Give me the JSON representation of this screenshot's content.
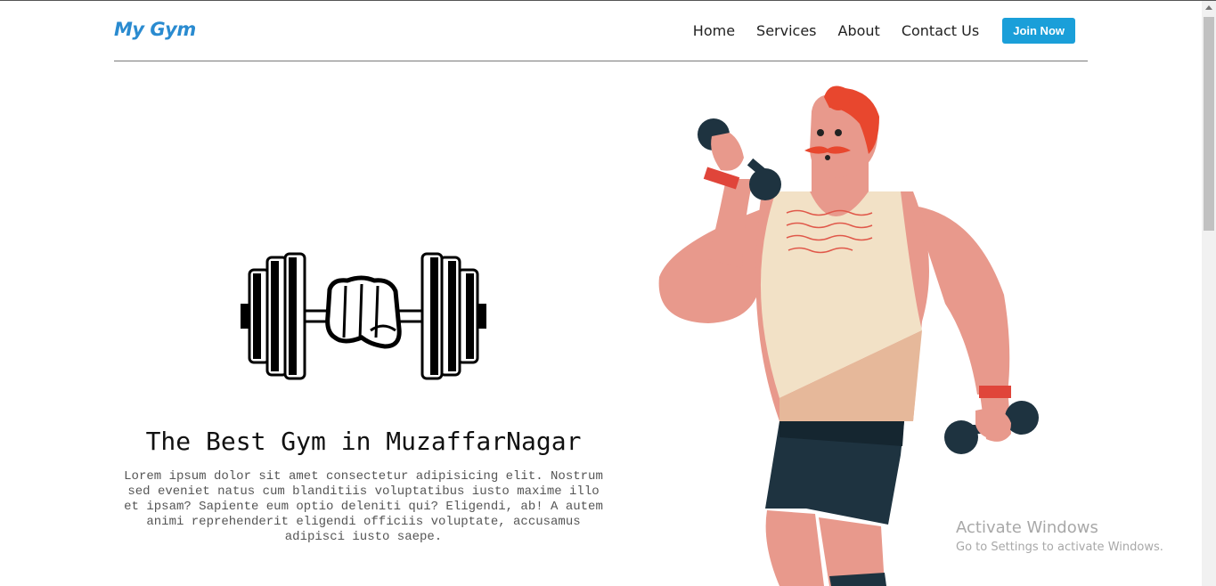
{
  "nav": {
    "logo": "My Gym",
    "links": [
      "Home",
      "Services",
      "About",
      "Contact Us"
    ],
    "cta": "Join Now"
  },
  "hero": {
    "title": "The Best Gym in MuzaffarNagar",
    "text": "Lorem ipsum dolor sit amet consectetur adipisicing elit. Nostrum sed eveniet natus cum blanditiis voluptatibus iusto maxime illo et ipsam? Sapiente eum optio deleniti qui? Eligendi, ab! A autem animi reprehenderit eligendi officiis voluptate, accusamus adipisci iusto saepe."
  },
  "watermark": {
    "title": "Activate Windows",
    "subtitle": "Go to Settings to activate Windows."
  },
  "colors": {
    "brand": "#2a8bd0",
    "button": "#1a9fd9",
    "skin": "#e8998c",
    "tank": "#f2e1c6",
    "shorts": "#1e3340",
    "hair": "#e8472e"
  }
}
